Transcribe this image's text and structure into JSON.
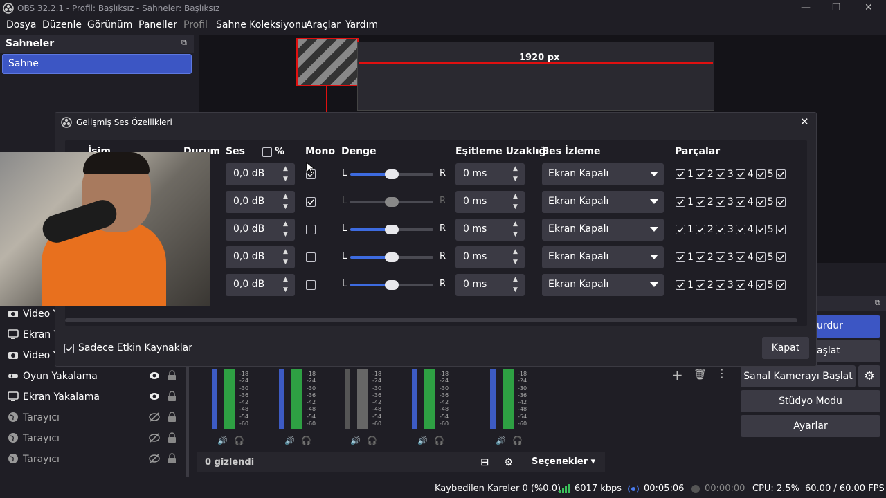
{
  "window": {
    "title": "OBS 32.2.1 - Profil: Başlıksız - Sahneler: Başlıksız"
  },
  "menu": [
    "Dosya",
    "Düzenle",
    "Görünüm",
    "Paneller",
    "Profil",
    "Sahne Koleksiyonu",
    "Araçlar",
    "Yardım"
  ],
  "scenes": {
    "title": "Sahneler",
    "items": [
      "Sahne"
    ]
  },
  "preview": {
    "width_label": "1920 px"
  },
  "dialog": {
    "title": "Gelişmiş Ses Özellikleri",
    "headers": {
      "name": "İsim",
      "status": "Durum",
      "volume": "Ses",
      "percent": "%",
      "mono": "Mono",
      "balance": "Denge",
      "sync": "Eşitleme Uzaklığı",
      "monitoring": "Ses İzleme",
      "tracks": "Parçalar"
    },
    "balance_left": "L",
    "balance_right": "R",
    "rows": [
      {
        "volume": "0,0 dB",
        "mono": true,
        "balance": 0.5,
        "sync": "0 ms",
        "monitoring": "Ekran Kapalı"
      },
      {
        "volume": "0,0 dB",
        "mono": true,
        "balance": 0.5,
        "sync": "0 ms",
        "monitoring": "Ekran Kapalı"
      },
      {
        "volume": "0,0 dB",
        "mono": false,
        "balance": 0.5,
        "sync": "0 ms",
        "monitoring": "Ekran Kapalı"
      },
      {
        "volume": "0,0 dB",
        "mono": false,
        "balance": 0.5,
        "sync": "0 ms",
        "monitoring": "Ekran Kapalı"
      },
      {
        "volume": "0,0 dB",
        "mono": false,
        "balance": 0.5,
        "sync": "0 ms",
        "monitoring": "Ekran Kapalı"
      }
    ],
    "track_numbers": [
      "1",
      "2",
      "3",
      "4",
      "5"
    ],
    "active_only_label": "Sadece Etkin Kaynaklar",
    "close_label": "Kapat"
  },
  "sources": [
    {
      "label": "Video Ya",
      "icon": "camera-icon"
    },
    {
      "label": "Ekran Ya",
      "icon": "monitor-icon"
    },
    {
      "label": "Video Ya",
      "icon": "camera-icon"
    },
    {
      "label": "Oyun Yakalama",
      "icon": "gamepad-icon",
      "visible": true
    },
    {
      "label": "Ekran Yakalama",
      "icon": "monitor-icon",
      "visible": true
    },
    {
      "label": "Tarayıcı",
      "icon": "globe-icon",
      "visible": false
    },
    {
      "label": "Tarayıcı",
      "icon": "globe-icon",
      "visible": false
    },
    {
      "label": "Tarayıcı",
      "icon": "globe-icon",
      "visible": false
    }
  ],
  "mixer": {
    "scale": [
      "-18",
      "-24",
      "-30",
      "-36",
      "-42",
      "-48",
      "-54",
      "-60"
    ],
    "hidden_label": "0 gizlendi",
    "options_label": "Seçenekler"
  },
  "controls": {
    "stop_label": "urdur",
    "start_label": "aşlat",
    "virtual_cam": "Sanal Kamerayı Başlat",
    "studio": "Stüdyo Modu",
    "settings": "Ayarlar"
  },
  "status": {
    "dropped": "Kaybedilen Kareler 0 (%0.0)",
    "kbps": "6017 kbps",
    "stream_time": "00:05:06",
    "rec_time": "00:00:00",
    "cpu": "CPU: 2.5%",
    "fps": "60.00 / 60.00 FPS"
  },
  "colors": {
    "accent": "#3c56c4",
    "bg": "#1f1e25",
    "panel": "#27262d",
    "input": "#3b3a44"
  }
}
